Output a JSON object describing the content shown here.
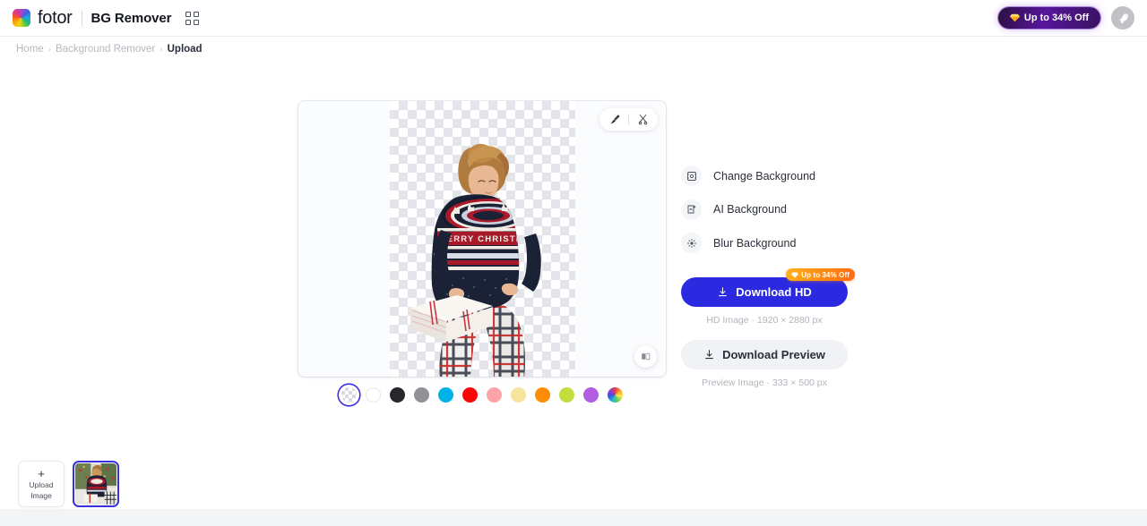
{
  "topbar": {
    "brand": "fotor",
    "app_title": "BG Remover",
    "apps_icon": "apps-grid-icon",
    "promo": {
      "label": "Up to 34% Off",
      "icon": "gem-icon",
      "bg_from": "#2b1040",
      "bg_to": "#57169b"
    },
    "avatar_icon": "bird-avatar-icon"
  },
  "breadcrumb": {
    "items": [
      {
        "label": "Home",
        "current": false
      },
      {
        "label": "Background Remover",
        "current": false
      },
      {
        "label": "Upload",
        "current": true
      }
    ],
    "separator": "›"
  },
  "canvas": {
    "tools": [
      {
        "name": "brush-tool",
        "icon": "brush-icon"
      },
      {
        "name": "erase-tool",
        "icon": "scissors-icon"
      }
    ],
    "compare_icon": "before-after-compare-icon",
    "subject_alt": "woman in merry christmas sweater holding gift box",
    "sweater_text": "MERRY CHRISTMAS"
  },
  "swatches": {
    "selected_index": 0,
    "items": [
      {
        "name": "transparent",
        "color": "transparent",
        "selected": true
      },
      {
        "name": "white",
        "color": "#ffffff",
        "selected": false
      },
      {
        "name": "black",
        "color": "#26262b",
        "selected": false
      },
      {
        "name": "gray",
        "color": "#909296",
        "selected": false
      },
      {
        "name": "cyan",
        "color": "#00b3e6",
        "selected": false
      },
      {
        "name": "red",
        "color": "#fb0606",
        "selected": false
      },
      {
        "name": "pink",
        "color": "#fba3a8",
        "selected": false
      },
      {
        "name": "yellow",
        "color": "#f6e49d",
        "selected": false
      },
      {
        "name": "orange",
        "color": "#fe8c04",
        "selected": false
      },
      {
        "name": "lime",
        "color": "#c4dc3d",
        "selected": false
      },
      {
        "name": "purple",
        "color": "#b25ee2",
        "selected": false
      },
      {
        "name": "custom-color-picker",
        "color": "rainbow",
        "selected": false
      }
    ]
  },
  "panel": {
    "options": [
      {
        "label": "Change Background",
        "icon": "change-background-icon"
      },
      {
        "label": "AI Background",
        "icon": "ai-background-icon"
      },
      {
        "label": "Blur Background",
        "icon": "blur-background-icon"
      }
    ],
    "download_hd": {
      "label": "Download HD",
      "icon": "download-icon",
      "badge": "Up to 34% Off",
      "badge_icon": "gem-icon",
      "note": "HD Image · 1920 × 2880 px",
      "color": "#2b2ae0"
    },
    "download_preview": {
      "label": "Download Preview",
      "icon": "download-icon",
      "note": "Preview Image · 333 × 500 px"
    }
  },
  "thumbnails": {
    "upload": {
      "plus": "+",
      "line1": "Upload",
      "line2": "Image"
    },
    "items": [
      {
        "name": "thumbnail-christmas-photo",
        "selected": true
      }
    ]
  }
}
